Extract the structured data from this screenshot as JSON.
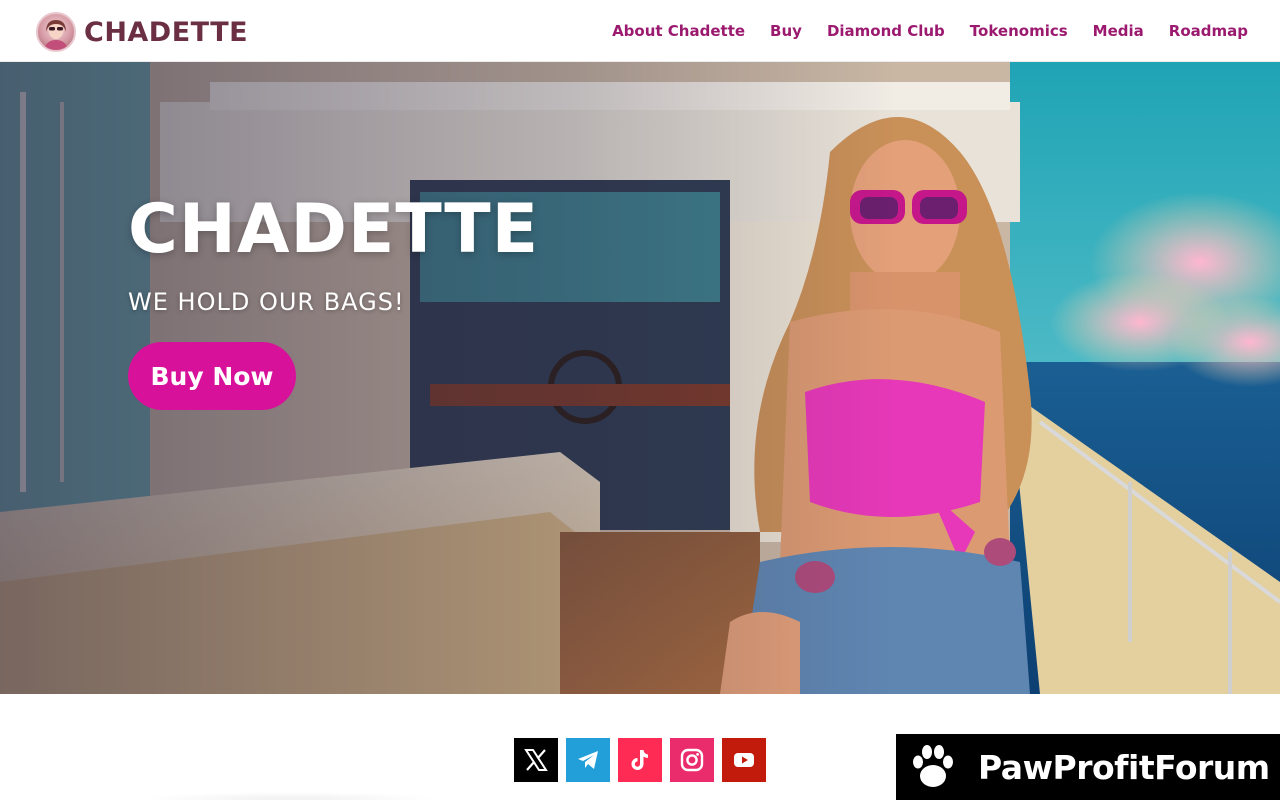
{
  "header": {
    "brand": "CHADETTE",
    "nav": [
      "About Chadette",
      "Buy",
      "Diamond Club",
      "Tokenomics",
      "Media",
      "Roadmap"
    ]
  },
  "hero": {
    "title": "CHADETTE",
    "subtitle": "WE HOLD OUR BAGS!",
    "cta": "Buy Now"
  },
  "socials": [
    "x-icon",
    "telegram-icon",
    "tiktok-icon",
    "instagram-icon",
    "youtube-icon"
  ],
  "watermark": {
    "text": "PawProfitForum"
  },
  "colors": {
    "brand": "#6a2f43",
    "nav": "#9b1a6f",
    "cta": "#d8119b"
  }
}
